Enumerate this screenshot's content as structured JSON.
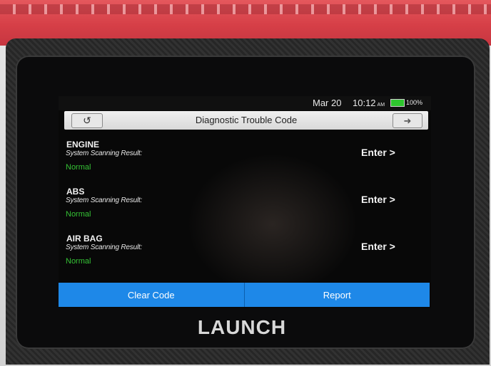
{
  "device": {
    "brand": "LAUNCH"
  },
  "status_bar": {
    "date": "Mar 20",
    "time": "10:12",
    "ampm": "AM",
    "battery": "100%",
    "battery_color": "#2ec52e"
  },
  "header": {
    "title": "Diagnostic Trouble Code",
    "back_icon": "back-arrow-icon",
    "exit_icon": "exit-icon"
  },
  "systems": [
    {
      "name": "ENGINE",
      "subtitle": "System Scanning Result:",
      "status": "Normal",
      "action": "Enter >"
    },
    {
      "name": "ABS",
      "subtitle": "System Scanning Result:",
      "status": "Normal",
      "action": "Enter >"
    },
    {
      "name": "AIR BAG",
      "subtitle": "System Scanning Result:",
      "status": "Normal",
      "action": "Enter >"
    }
  ],
  "footer": {
    "clear_label": "Clear Code",
    "report_label": "Report",
    "accent": "#1e88e8"
  },
  "colors": {
    "status_normal": "#35c235"
  }
}
